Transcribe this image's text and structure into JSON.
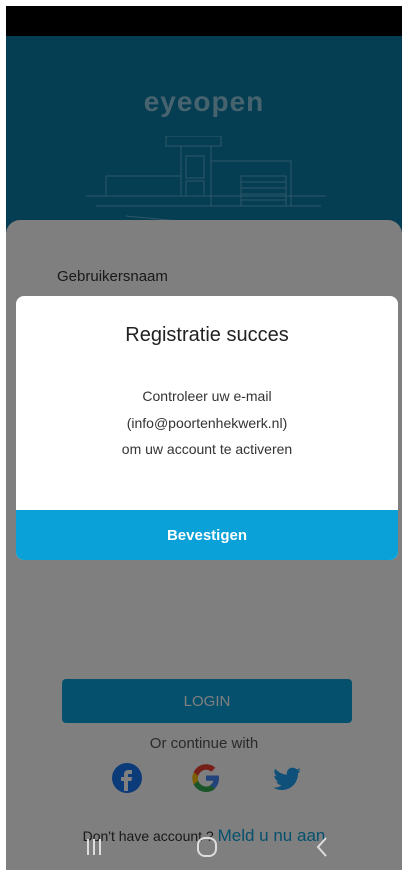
{
  "header": {
    "brand": "eyeopen"
  },
  "login_form": {
    "username_label": "Gebruikersnaam",
    "login_label": "LOGIN",
    "continue_text": "Or continue with",
    "social_icons": [
      "facebook-icon",
      "google-icon",
      "twitter-icon"
    ],
    "signup_prompt": "Don't have account ?",
    "signup_link": "Meld u nu aan"
  },
  "dialog": {
    "title": "Registratie succes",
    "message_lines": [
      "Controleer uw e-mail",
      "(info@poortenhekwerk.nl)",
      "om uw account te activeren"
    ],
    "confirm_label": "Bevestigen"
  },
  "nav_bar": {
    "icons": [
      "recent-apps-icon",
      "home-icon",
      "back-icon"
    ]
  },
  "colors": {
    "primary": "#0aa0d8",
    "header_bg": "#0a7aa5",
    "overlay": "rgba(0,0,0,0.5)"
  }
}
